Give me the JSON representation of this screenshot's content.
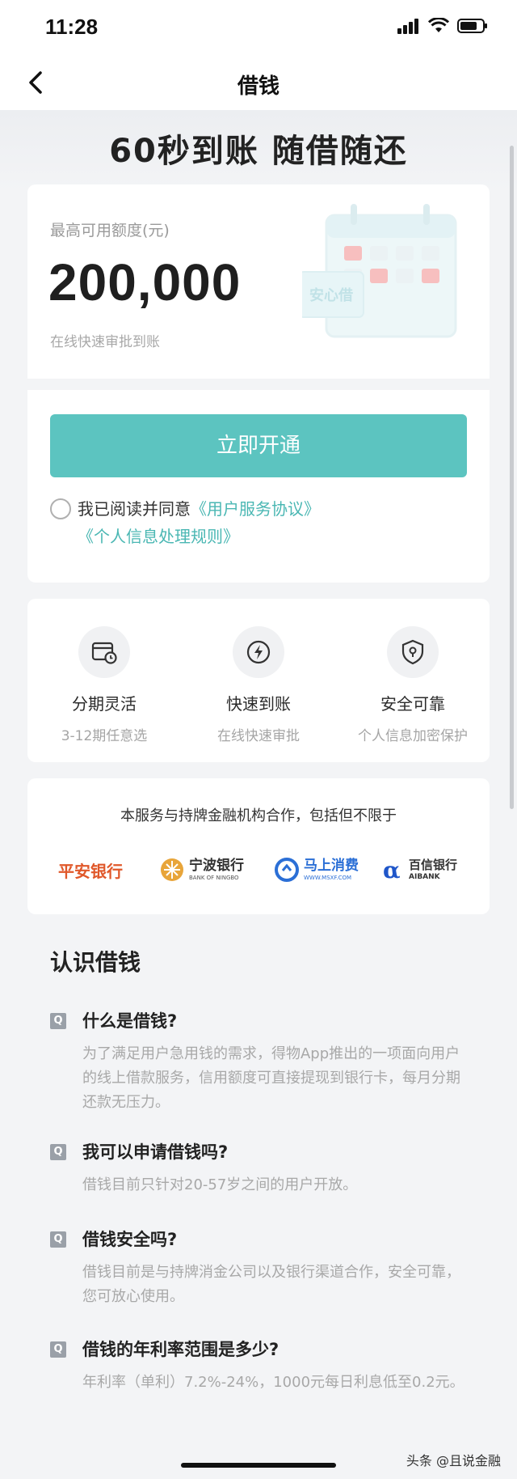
{
  "status_bar": {
    "time": "11:28"
  },
  "nav": {
    "title": "借钱"
  },
  "hero": {
    "title": "60秒到账 随借随还"
  },
  "credit": {
    "label": "最高可用额度(元)",
    "amount": "200,000",
    "subtext": "在线快速审批到账",
    "illustration_text": "安心借"
  },
  "action": {
    "open_label": "立即开通",
    "agree_prefix": "我已阅读并同意",
    "agreement_link": "《用户服务协议》",
    "privacy_link": "《个人信息处理规则》",
    "agreed": false
  },
  "features": [
    {
      "icon": "card-clock-icon",
      "title": "分期灵活",
      "desc": "3-12期任意选"
    },
    {
      "icon": "lightning-icon",
      "title": "快速到账",
      "desc": "在线快速审批"
    },
    {
      "icon": "shield-lock-icon",
      "title": "安全可靠",
      "desc": "个人信息加密保护"
    }
  ],
  "partners": {
    "title": "本服务与持牌金融机构合作，包括但不限于",
    "items": [
      {
        "name": "平安银行",
        "color": "#e0582a"
      },
      {
        "name": "宁波银行",
        "sub": "BANK OF NINGBO",
        "color": "#e8a53a"
      },
      {
        "name": "马上消费",
        "sub": "WWW.MSXF.COM",
        "color": "#2b6fd6"
      },
      {
        "name": "百信银行",
        "sub": "AIBANK",
        "color": "#1f56c9"
      }
    ]
  },
  "faq": {
    "heading": "认识借钱",
    "badge": "Q",
    "items": [
      {
        "q": "什么是借钱?",
        "a": "为了满足用户急用钱的需求，得物App推出的一项面向用户的线上借款服务，信用额度可直接提现到银行卡，每月分期还款无压力。"
      },
      {
        "q": "我可以申请借钱吗?",
        "a": "借钱目前只针对20-57岁之间的用户开放。"
      },
      {
        "q": "借钱安全吗?",
        "a": "借钱目前是与持牌消金公司以及银行渠道合作，安全可靠，您可放心使用。"
      },
      {
        "q": "借钱的年利率范围是多少?",
        "a": "年利率（单利）7.2%-24%，1000元每日利息低至0.2元。"
      }
    ]
  },
  "watermark": "头条 @且说金融",
  "colors": {
    "accent": "#5cc4c0",
    "link": "#4ab7b3"
  }
}
